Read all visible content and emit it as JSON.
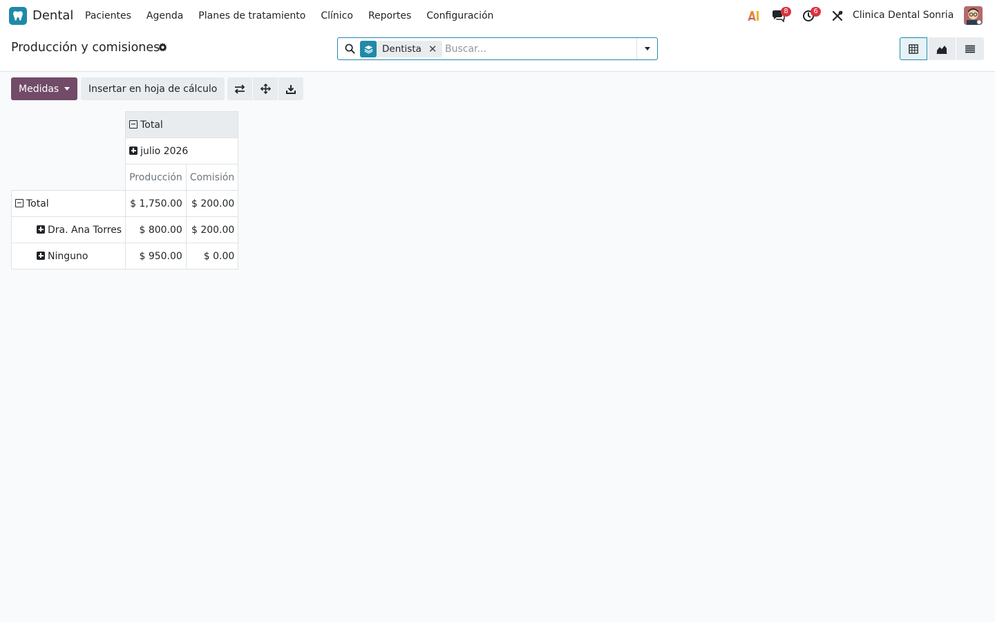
{
  "navbar": {
    "app_name": "Dental",
    "menu": [
      "Pacientes",
      "Agenda",
      "Planes de tratamiento",
      "Clínico",
      "Reportes",
      "Configuración"
    ],
    "messages_count": "8",
    "activities_count": "6",
    "company": "Clinica Dental Sonria"
  },
  "control": {
    "title": "Producción y comisiones",
    "search": {
      "facet_label": "Dentista",
      "placeholder": "Buscar..."
    }
  },
  "toolbar": {
    "measures_label": "Medidas",
    "insert_label": "Insertar en hoja de cálculo"
  },
  "pivot": {
    "col_total": "Total",
    "col_month": "julio 2026",
    "measures": [
      "Producción",
      "Comisión"
    ],
    "rows": [
      {
        "label": "Total",
        "produccion": "$ 1,750.00",
        "comision": "$ 200.00"
      },
      {
        "label": "Dra. Ana Torres",
        "produccion": "$ 800.00",
        "comision": "$ 200.00"
      },
      {
        "label": "Ninguno",
        "produccion": "$ 950.00",
        "comision": "$ 0.00"
      }
    ]
  },
  "colors": {
    "primary": "#714b67",
    "accent": "#1f8aa8",
    "badge": "#d9333f"
  }
}
